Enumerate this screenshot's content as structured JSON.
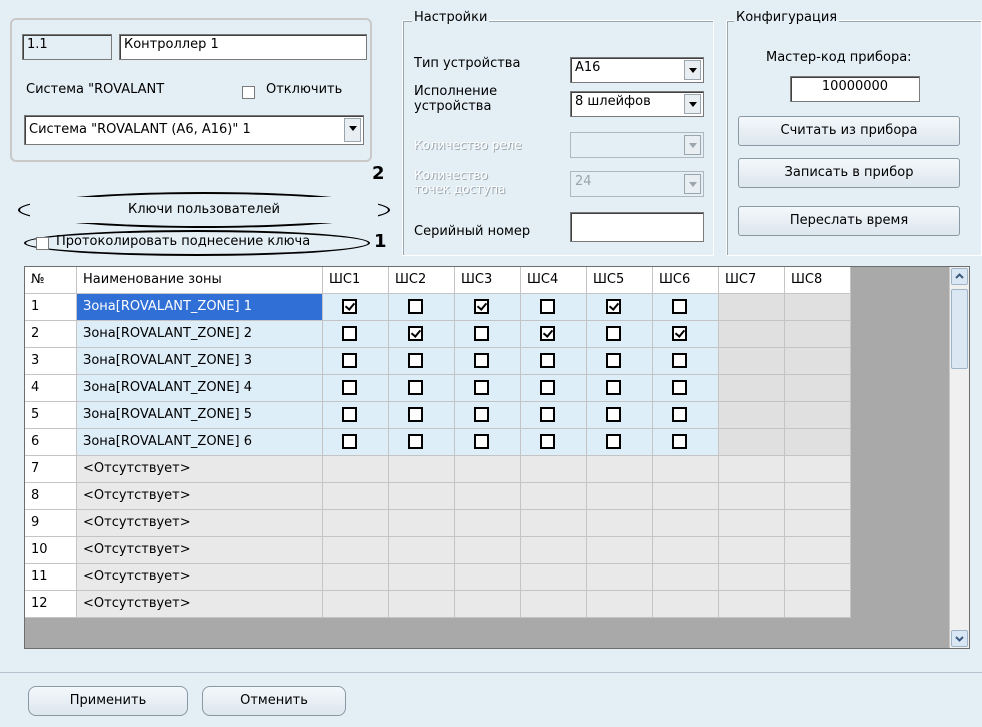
{
  "controller": {
    "id": "1.1",
    "name": "Контроллер 1",
    "system_label": "Система \"ROVALANT",
    "disable_label": "Отключить",
    "system_select": "Система \"ROVALANT (A6, A16)\" 1"
  },
  "left_actions": {
    "user_keys_button": "Ключи пользователей",
    "log_key_label": "Протоколировать поднесение ключа",
    "marker_1": "1",
    "marker_2": "2"
  },
  "settings": {
    "legend": "Настройки",
    "device_type_label": "Тип устройства",
    "device_type_value": "A16",
    "execution_label_1": "Исполнение",
    "execution_label_2": "устройства",
    "execution_value": "8 шлейфов",
    "relay_count_label": "Количество реле",
    "access_points_label_1": "Количество",
    "access_points_label_2": "точек доступа",
    "access_points_value": "24",
    "serial_label": "Серийный номер",
    "serial_value": ""
  },
  "config": {
    "legend": "Конфигурация",
    "master_code_label": "Мастер-код прибора:",
    "master_code_value": "10000000",
    "read_button": "Считать из прибора",
    "write_button": "Записать в прибор",
    "send_time_button": "Переслать время"
  },
  "grid": {
    "headers": [
      "№",
      "Наименование зоны",
      "ШС1",
      "ШС2",
      "ШС3",
      "ШС4",
      "ШС5",
      "ШС6",
      "ШС7",
      "ШС8"
    ],
    "rows": [
      {
        "num": "1",
        "name": "Зона[ROVALANT_ZONE] 1",
        "checks": [
          true,
          false,
          true,
          false,
          true,
          false
        ]
      },
      {
        "num": "2",
        "name": "Зона[ROVALANT_ZONE] 2",
        "checks": [
          false,
          true,
          false,
          true,
          false,
          true
        ]
      },
      {
        "num": "3",
        "name": "Зона[ROVALANT_ZONE] 3",
        "checks": [
          false,
          false,
          false,
          false,
          false,
          false
        ]
      },
      {
        "num": "4",
        "name": "Зона[ROVALANT_ZONE] 4",
        "checks": [
          false,
          false,
          false,
          false,
          false,
          false
        ]
      },
      {
        "num": "5",
        "name": "Зона[ROVALANT_ZONE] 5",
        "checks": [
          false,
          false,
          false,
          false,
          false,
          false
        ]
      },
      {
        "num": "6",
        "name": "Зона[ROVALANT_ZONE] 6",
        "checks": [
          false,
          false,
          false,
          false,
          false,
          false
        ]
      },
      {
        "num": "7",
        "name": "<Отсутствует>",
        "checks": null
      },
      {
        "num": "8",
        "name": "<Отсутствует>",
        "checks": null
      },
      {
        "num": "9",
        "name": "<Отсутствует>",
        "checks": null
      },
      {
        "num": "10",
        "name": "<Отсутствует>",
        "checks": null
      },
      {
        "num": "11",
        "name": "<Отсутствует>",
        "checks": null
      },
      {
        "num": "12",
        "name": "<Отсутствует>",
        "checks": null
      }
    ]
  },
  "footer": {
    "apply_button": "Применить",
    "cancel_button": "Отменить"
  }
}
